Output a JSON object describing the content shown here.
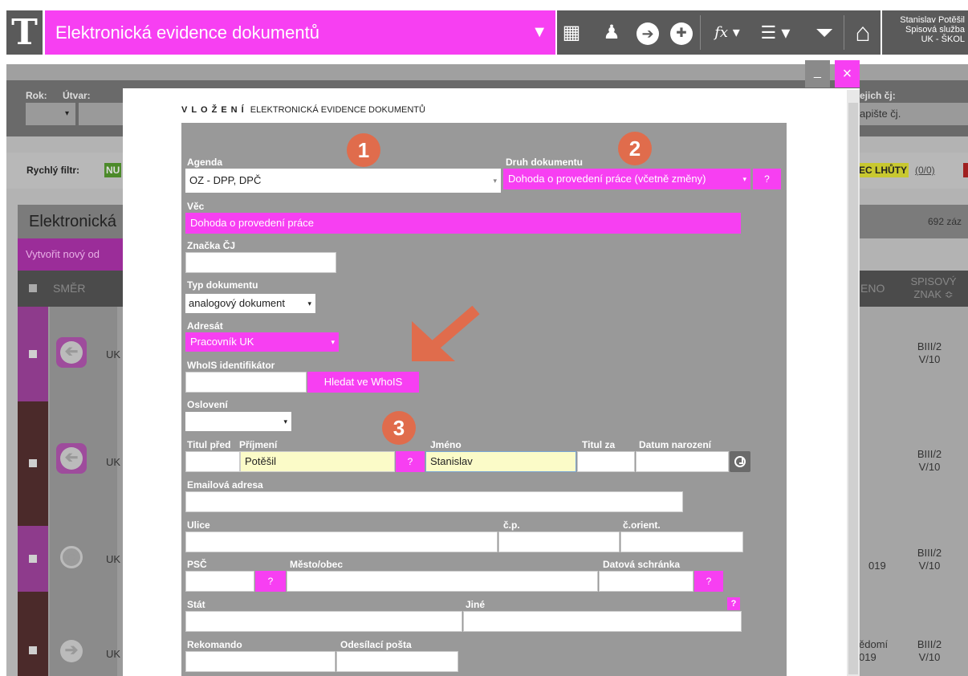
{
  "app": {
    "logo": "T",
    "title": "Elektronická evidence dokumentů",
    "title_caret": "▼",
    "user": {
      "name": "Stanislav Potěšil",
      "role": "Spisová služba",
      "unit": "UK - ŠKOL"
    }
  },
  "toolbar": [
    {
      "icon": "grid-icon",
      "glyph": "▦"
    },
    {
      "icon": "person-icon",
      "glyph": "♟"
    },
    {
      "icon": "arrow-right-circle-icon",
      "glyph": "➔"
    },
    {
      "icon": "plus-circle-icon",
      "glyph": "✚"
    },
    {
      "icon": "function-icon",
      "glyph": "f𝑥 ▾"
    },
    {
      "icon": "list-icon",
      "glyph": "☰ ▾"
    },
    {
      "icon": "filter-icon",
      "glyph": "⏷"
    },
    {
      "icon": "home-icon",
      "glyph": "⌂"
    }
  ],
  "background": {
    "filter_labels": {
      "rok": "Rok:",
      "utvar": "Útvar:",
      "nasich": "ejich čj:"
    },
    "filter_rok_value": "▾",
    "filter_cj_placeholder": "apište čj.",
    "quick_filter_label": "Rychlý filtr:",
    "quick_filter_first": "NU",
    "quick_filter_right": "EC LHŮTY",
    "quick_filter_right_count": "(0/0)",
    "list_title": "Elektronická",
    "record_count": "692 záz",
    "new_button": "Vytvořit nový od",
    "columns": {
      "smer": "SMĚR",
      "jmeno": "ENO",
      "spisovy_znak": "SPISOVÝ ZNAK ≎"
    },
    "rows": [
      {
        "uk": "UK",
        "icon": "arrow-left-circle-icon",
        "glyph": "➔",
        "date": "",
        "znak1": "BIII/2",
        "znak2": "V/10"
      },
      {
        "uk": "UK",
        "icon": "arrow-left-circle-icon",
        "glyph": "➔",
        "date": "",
        "znak1": "BIII/2",
        "znak2": "V/10"
      },
      {
        "uk": "UK",
        "icon": "circle-icon",
        "glyph": "○",
        "date": "019",
        "znak1": "BIII/2",
        "znak2": "V/10"
      },
      {
        "uk": "UK",
        "icon": "arrow-right-circle-icon",
        "glyph": "➔",
        "date": "ědomí 019",
        "znak1": "BIII/2",
        "znak2": "V/10"
      }
    ]
  },
  "modal": {
    "title_strong": "VLOŽENÍ",
    "title_rest": "ELEKTRONICKÁ EVIDENCE DOKUMENTŮ",
    "min_label": "_",
    "close_label": "×",
    "badges": [
      "1",
      "2",
      "3"
    ],
    "fields": {
      "agenda": {
        "label": "Agenda",
        "value": "OZ - DPP, DPČ"
      },
      "druh": {
        "label": "Druh dokumentu",
        "value": "Dohoda o provedení práce (včetně změny)"
      },
      "vec": {
        "label": "Věc",
        "value": "Dohoda o provedení práce"
      },
      "znacka": {
        "label": "Značka ČJ",
        "value": ""
      },
      "typ": {
        "label": "Typ dokumentu",
        "value": "analogový dokument"
      },
      "adresat": {
        "label": "Adresát",
        "value": "Pracovník UK"
      },
      "whois": {
        "label": "WhoIS identifikátor",
        "value": "",
        "button": "Hledat ve WhoIS"
      },
      "osloveni": {
        "label": "Oslovení",
        "value": ""
      },
      "titul_pred": {
        "label": "Titul před",
        "value": ""
      },
      "prijmeni": {
        "label": "Příjmení",
        "value": "Potěšil"
      },
      "jmeno": {
        "label": "Jméno",
        "value": "Stanislav"
      },
      "titul_za": {
        "label": "Titul za",
        "value": ""
      },
      "datum": {
        "label": "Datum narození",
        "value": ""
      },
      "email": {
        "label": "Emailová adresa",
        "value": ""
      },
      "ulice": {
        "label": "Ulice",
        "value": ""
      },
      "cp": {
        "label": "č.p.",
        "value": ""
      },
      "corient": {
        "label": "č.orient.",
        "value": ""
      },
      "psc": {
        "label": "PSČ",
        "value": ""
      },
      "mesto": {
        "label": "Město/obec",
        "value": ""
      },
      "datova": {
        "label": "Datová schránka",
        "value": ""
      },
      "stat": {
        "label": "Stát",
        "value": ""
      },
      "jine": {
        "label": "Jiné",
        "value": ""
      },
      "rekomando": {
        "label": "Rekomando",
        "value": ""
      },
      "odesilaci": {
        "label": "Odesílací pošta",
        "value": ""
      }
    },
    "help": "?",
    "dropdown_caret": "▾"
  },
  "colors": {
    "accent": "#f73ff2",
    "badge": "#e06c4c",
    "highlight": "#fbfbc8"
  }
}
